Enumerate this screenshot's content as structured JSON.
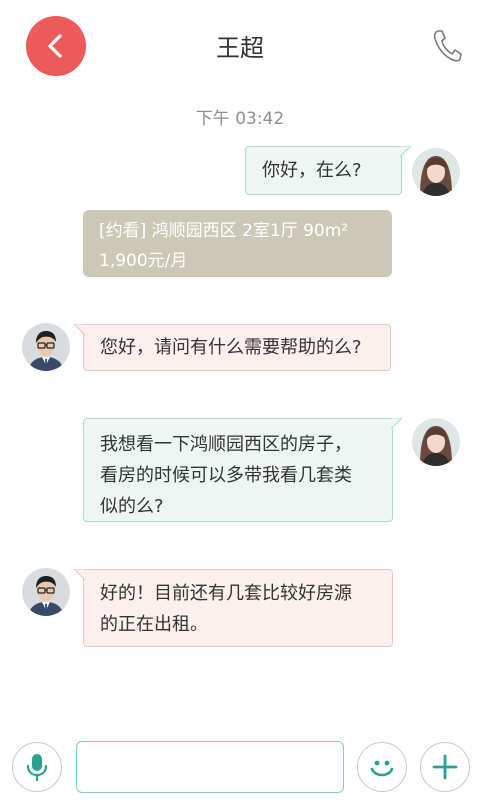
{
  "header": {
    "title": "王超",
    "back_icon": "chevron-left-icon",
    "call_icon": "phone-icon"
  },
  "conversation": {
    "timestamp": "下午 03:42",
    "messages": [
      {
        "from": "me",
        "lines": [
          "你好，在么?"
        ]
      },
      {
        "from": "card",
        "lines": [
          "[约看] 鸿顺园西区  2室1厅  90m²",
          "1,900元/月"
        ]
      },
      {
        "from": "agent",
        "lines": [
          "您好，请问有什么需要帮助的么?"
        ]
      },
      {
        "from": "me",
        "lines": [
          "我想看一下鸿顺园西区的房子，",
          "看房的时候可以多带我看几套类",
          "似的么?"
        ]
      },
      {
        "from": "agent",
        "lines": [
          "好的！目前还有几套比较好房源",
          "的正在出租。"
        ]
      }
    ]
  },
  "input_bar": {
    "voice_icon": "microphone-icon",
    "input_value": "",
    "input_placeholder": "",
    "emoji_icon": "smiley-icon",
    "more_icon": "plus-icon"
  },
  "colors": {
    "accent": "#2aa193",
    "back_button": "#ec5a5a",
    "card_bg": "#ccc8b6",
    "out_bubble_bg": "#eef6f4",
    "in_bubble_bg": "#fcf0ef"
  }
}
